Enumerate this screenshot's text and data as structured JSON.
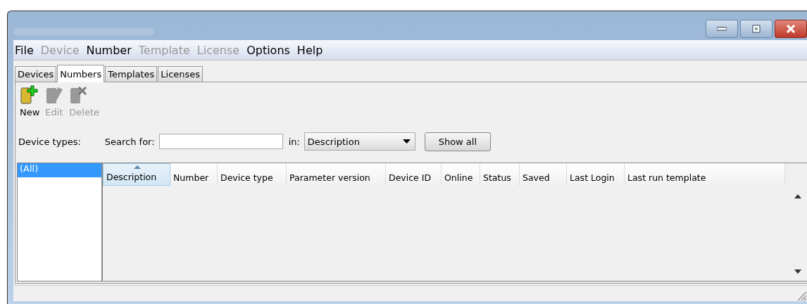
{
  "menu": [
    {
      "label": "File",
      "disabled": false
    },
    {
      "label": "Device",
      "disabled": true
    },
    {
      "label": "Number",
      "disabled": false
    },
    {
      "label": "Template",
      "disabled": true
    },
    {
      "label": "License",
      "disabled": true
    },
    {
      "label": "Options",
      "disabled": false
    },
    {
      "label": "Help",
      "disabled": false
    }
  ],
  "tabs": [
    {
      "label": "Devices",
      "selected": false
    },
    {
      "label": "Numbers",
      "selected": true
    },
    {
      "label": "Templates",
      "selected": false
    },
    {
      "label": "Licenses",
      "selected": false
    }
  ],
  "toolbar": [
    {
      "kind": "new",
      "label": "New",
      "disabled": false
    },
    {
      "kind": "edit",
      "label": "Edit",
      "disabled": true
    },
    {
      "kind": "delete",
      "label": "Delete",
      "disabled": true
    }
  ],
  "filter": {
    "device_types_label": {
      "label": "Device types:"
    },
    "search_label": {
      "label": "Search for:"
    },
    "in_label": "in:",
    "in_value": "Description",
    "show_all": {
      "label": "Show all"
    }
  },
  "device_types": [
    {
      "label": "(All)",
      "selected": true
    }
  ],
  "table": {
    "columns": [
      {
        "label": "Description",
        "sorted": true
      },
      {
        "label": "Number",
        "sorted": false
      },
      {
        "label": "Device type",
        "sorted": false
      },
      {
        "label": "Parameter version",
        "sorted": false
      },
      {
        "label": "Device ID",
        "sorted": false
      },
      {
        "label": "Online",
        "sorted": false
      },
      {
        "label": "Status",
        "sorted": false
      },
      {
        "label": "Saved",
        "sorted": false
      },
      {
        "label": "Last Login",
        "sorted": false
      },
      {
        "label": "Last run template",
        "sorted": false
      }
    ]
  }
}
